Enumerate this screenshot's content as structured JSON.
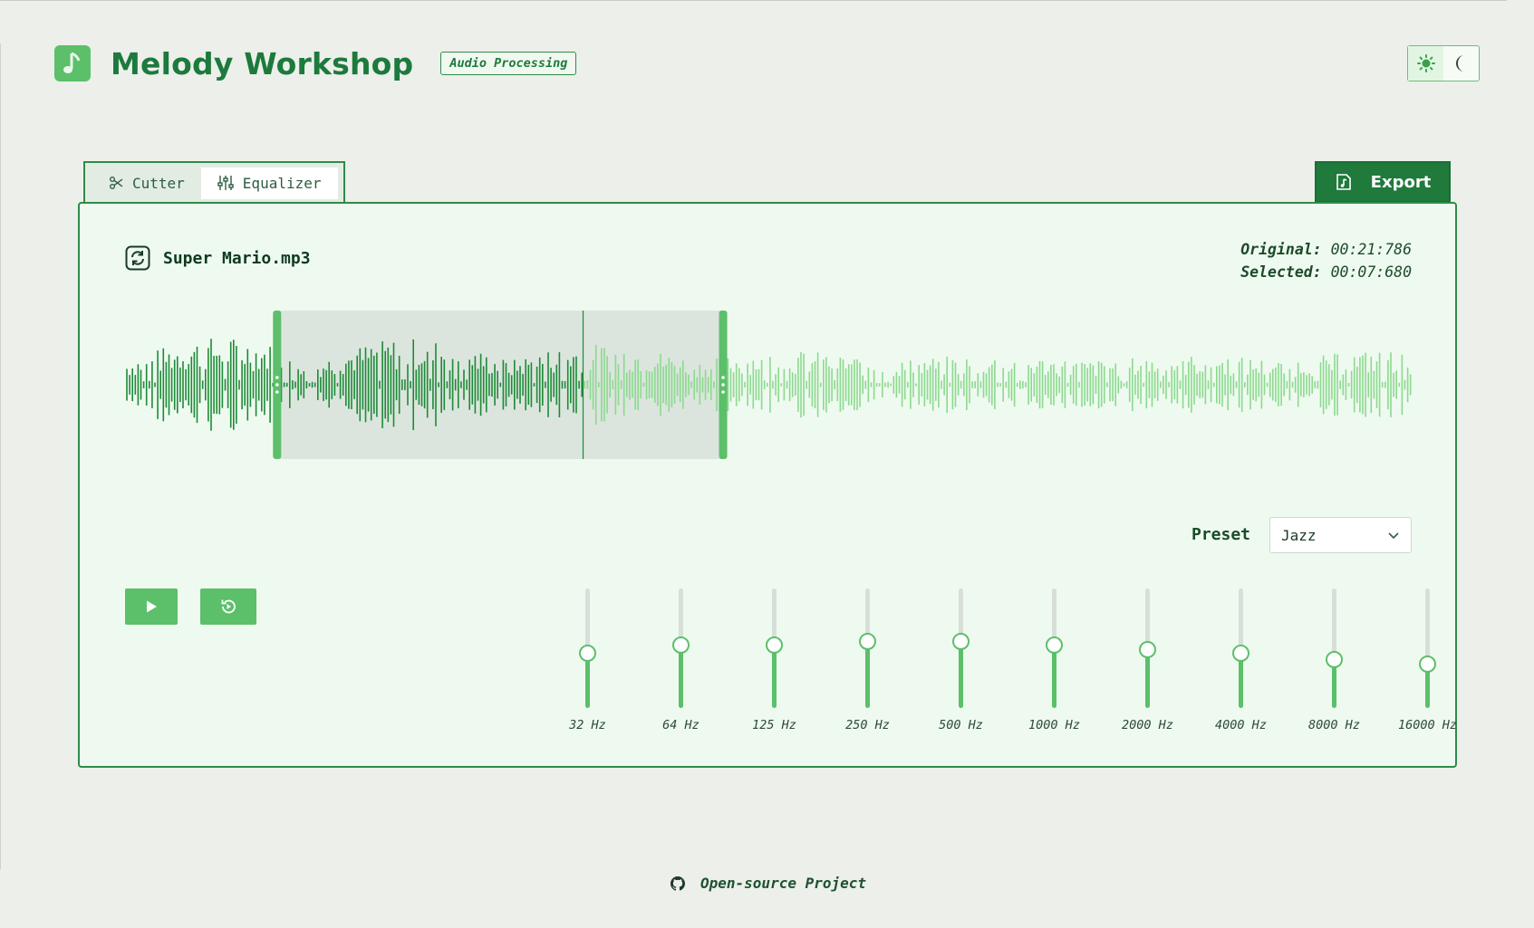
{
  "app": {
    "title": "Melody Workshop",
    "badge": "Audio Processing",
    "logo_icon": "music-note-icon"
  },
  "theme": {
    "options": [
      "light",
      "dark"
    ],
    "active": "light"
  },
  "tabs": [
    {
      "label": "Cutter",
      "icon": "scissors-icon",
      "active": false
    },
    {
      "label": "Equalizer",
      "icon": "sliders-icon",
      "active": true
    }
  ],
  "export": {
    "label": "Export",
    "icon": "file-music-icon"
  },
  "file": {
    "name": "Super Mario.mp3",
    "icon": "refresh-icon"
  },
  "times": {
    "original_label": "Original:",
    "original_value": "00:21:786",
    "selected_label": "Selected:",
    "selected_value": "00:07:680"
  },
  "selection": {
    "start_fraction": 0.115,
    "end_fraction": 0.468,
    "playhead_fraction": 0.356
  },
  "colors": {
    "accent": "#5cbf6a",
    "dark": "#1f7a3c",
    "wave_active": "#1e8a38",
    "wave_inactive": "#8cd98f",
    "selection_bg": "#dbe5dd"
  },
  "preset": {
    "label": "Preset",
    "value": "Jazz"
  },
  "controls": {
    "play_icon": "play-icon",
    "replay_icon": "replay-icon"
  },
  "equalizer": {
    "bands": [
      {
        "label": "32 Hz",
        "level": 0.5
      },
      {
        "label": "64 Hz",
        "level": 0.57
      },
      {
        "label": "125 Hz",
        "level": 0.57
      },
      {
        "label": "250 Hz",
        "level": 0.6
      },
      {
        "label": "500 Hz",
        "level": 0.6
      },
      {
        "label": "1000 Hz",
        "level": 0.57
      },
      {
        "label": "2000 Hz",
        "level": 0.53
      },
      {
        "label": "4000 Hz",
        "level": 0.5
      },
      {
        "label": "8000 Hz",
        "level": 0.44
      },
      {
        "label": "16000 Hz",
        "level": 0.4
      }
    ]
  },
  "footer": {
    "label": "Open-source Project",
    "icon": "github-icon"
  }
}
